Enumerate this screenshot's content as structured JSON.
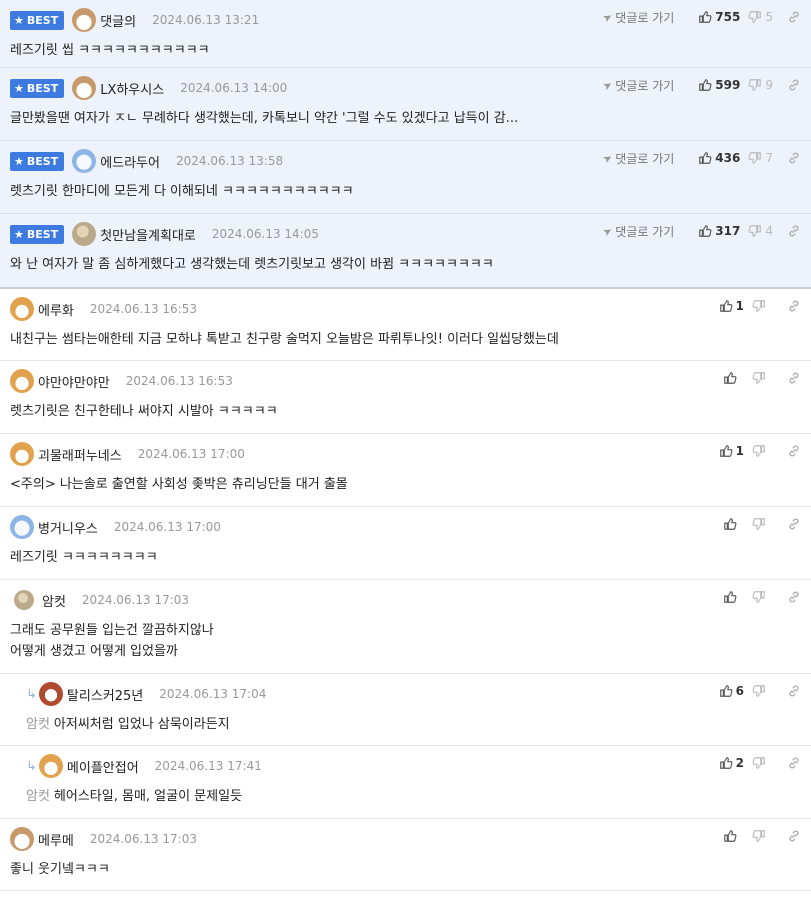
{
  "labels": {
    "best": "BEST",
    "goto": "댓글로 가기"
  },
  "comments": [
    {
      "best": true,
      "avatar": "dog",
      "nickname": "댓글의",
      "date": "2024.06.13 13:21",
      "body": "레즈기릿 씹 ㅋㅋㅋㅋㅋㅋㅋㅋㅋㅋㅋ",
      "up": "755",
      "down": "5"
    },
    {
      "best": true,
      "avatar": "dog",
      "nickname": "LX하우시스",
      "date": "2024.06.13 14:00",
      "body": "글만봤을땐 여자가 ㅈㄴ 무례하다 생각했는데, 카톡보니 약간 '그럴 수도 있겠다고 납득이 감...",
      "up": "599",
      "down": "9"
    },
    {
      "best": true,
      "avatar": "ghost",
      "nickname": "에드라두어",
      "date": "2024.06.13 13:58",
      "body": "렛츠기릿 한마디에 모든게 다 이해되네 ㅋㅋㅋㅋㅋㅋㅋㅋㅋㅋㅋ",
      "up": "436",
      "down": "7"
    },
    {
      "best": true,
      "avatar": "blob",
      "nickname": "첫만남을계획대로",
      "date": "2024.06.13 14:05",
      "body": "와 난 여자가 말 좀 심하게했다고 생각했는데 렛츠기릿보고 생각이 바뀜 ㅋㅋㅋㅋㅋㅋㅋㅋ",
      "up": "317",
      "down": "4"
    },
    {
      "best": false,
      "avatar": "fox",
      "nickname": "에루화",
      "date": "2024.06.13 16:53",
      "body": "내친구는 썸타는애한테 지금 모하냐 톡받고 친구랑 술먹지 오늘밤은 파뤼투나잇! 이러다 일씹당했는데",
      "up": "1",
      "down": ""
    },
    {
      "best": false,
      "avatar": "fox",
      "nickname": "야만야만야만",
      "date": "2024.06.13 16:53",
      "body": "렛츠기릿은 친구한테나 써야지 시발아 ㅋㅋㅋㅋㅋ",
      "up": "",
      "down": ""
    },
    {
      "best": false,
      "avatar": "fox",
      "nickname": "괴물래퍼누네스",
      "date": "2024.06.13 17:00",
      "body": "<주의> 나는솔로 출연할 사회성 좆박은 츄리닝단들 대거 출몰",
      "up": "1",
      "down": ""
    },
    {
      "best": false,
      "avatar": "ghost",
      "nickname": "병거니우스",
      "date": "2024.06.13 17:00",
      "body": "레즈기릿 ㅋㅋㅋㅋㅋㅋㅋㅋ",
      "up": "",
      "down": ""
    },
    {
      "best": false,
      "avatar": "blob",
      "nickname": "암컷",
      "date": "2024.06.13 17:03",
      "body": "그래도 공무원들 입는건 깔끔하지않나\n어떻게 생겼고 어떻게 입었을까",
      "up": "",
      "down": ""
    },
    {
      "best": false,
      "reply": true,
      "avatar": "mask",
      "nickname": "탈리스커25년",
      "date": "2024.06.13 17:04",
      "mention": "암컷",
      "body": "아저씨처럼 입었나 삼묵이라든지",
      "up": "6",
      "down": ""
    },
    {
      "best": false,
      "reply": true,
      "avatar": "fox",
      "nickname": "메이플안접어",
      "date": "2024.06.13 17:41",
      "mention": "암컷",
      "body": "헤어스타일, 몸매, 얼굴이 문제일듯",
      "up": "2",
      "down": ""
    },
    {
      "best": false,
      "avatar": "dog",
      "nickname": "메루메",
      "date": "2024.06.13 17:03",
      "body": "좋니 웃기넼ㅋㅋㅋ",
      "up": "",
      "down": ""
    }
  ]
}
